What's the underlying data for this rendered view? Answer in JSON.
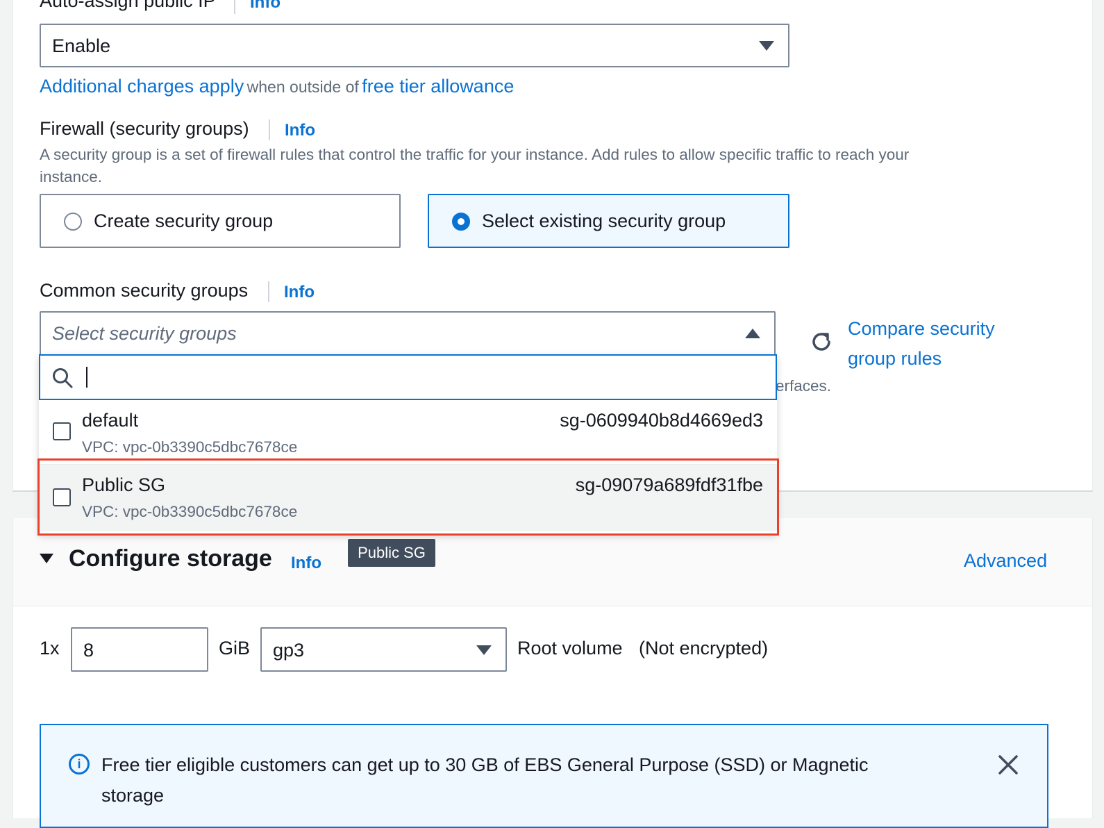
{
  "public_ip": {
    "label": "Auto-assign public IP",
    "info": "Info",
    "value": "Enable",
    "charges_link": "Additional charges apply",
    "charges_mid": "when outside of",
    "free_tier_link": "free tier allowance"
  },
  "firewall": {
    "label": "Firewall (security groups)",
    "info": "Info",
    "description_line1": "A security group is a set of firewall rules that control the traffic for your instance. Add rules to allow specific traffic to reach your",
    "description_line2": "instance.",
    "options": [
      {
        "label": "Create security group",
        "selected": false
      },
      {
        "label": "Select existing security group",
        "selected": true
      }
    ]
  },
  "common_sg": {
    "label": "Common security groups",
    "info": "Info",
    "placeholder": "Select security groups",
    "compare_link_line1": "Compare security",
    "compare_link_line2": "group rules",
    "hidden_text_fragment": "erfaces.",
    "search_value": "",
    "options": [
      {
        "name": "default",
        "vpc": "VPC: vpc-0b3390c5dbc7678ce",
        "id": "sg-0609940b8d4669ed3",
        "checked": false
      },
      {
        "name": "Public SG",
        "vpc": "VPC: vpc-0b3390c5dbc7678ce",
        "id": "sg-09079a689fdf31fbe",
        "checked": false
      }
    ],
    "tooltip": "Public SG"
  },
  "storage": {
    "title": "Configure storage",
    "info": "Info",
    "advanced": "Advanced",
    "count_prefix": "1x",
    "size_value": "8",
    "unit": "GiB",
    "volume_type": "gp3",
    "root_label": "Root volume",
    "encryption": "(Not encrypted)",
    "notice_line1": "Free tier eligible customers can get up to 30 GB of EBS General Purpose (SSD) or Magnetic",
    "notice_line2": "storage"
  },
  "colors": {
    "accent": "#0972d3",
    "highlight": "#e8412c"
  }
}
